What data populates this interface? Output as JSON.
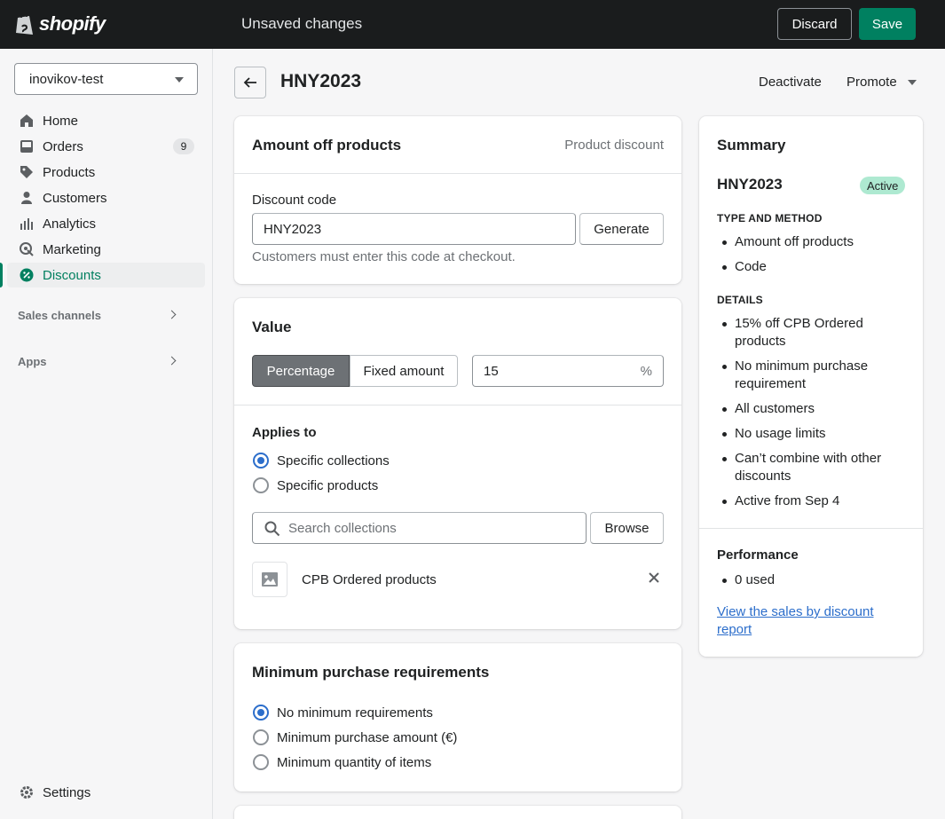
{
  "topbar": {
    "logo_text": "shopify",
    "status": "Unsaved changes",
    "discard_label": "Discard",
    "save_label": "Save"
  },
  "sidebar": {
    "store_name": "inovikov-test",
    "items": [
      {
        "label": "Home",
        "icon": "home-icon"
      },
      {
        "label": "Orders",
        "icon": "orders-icon",
        "badge": "9"
      },
      {
        "label": "Products",
        "icon": "tag-icon"
      },
      {
        "label": "Customers",
        "icon": "person-icon"
      },
      {
        "label": "Analytics",
        "icon": "bar-chart-icon"
      },
      {
        "label": "Marketing",
        "icon": "target-icon"
      },
      {
        "label": "Discounts",
        "icon": "discount-icon",
        "active": true
      }
    ],
    "sales_channels_label": "Sales channels",
    "apps_label": "Apps",
    "settings_label": "Settings"
  },
  "header": {
    "title": "HNY2023",
    "deactivate_label": "Deactivate",
    "promote_label": "Promote"
  },
  "discount_card": {
    "title": "Amount off products",
    "type_label": "Product discount",
    "code_label": "Discount code",
    "code_value": "HNY2023",
    "generate_label": "Generate",
    "help_text": "Customers must enter this code at checkout."
  },
  "value_card": {
    "title": "Value",
    "percentage_label": "Percentage",
    "fixed_amount_label": "Fixed amount",
    "value": "15",
    "suffix": "%",
    "applies_to_label": "Applies to",
    "option_collections": "Specific collections",
    "option_products": "Specific products",
    "search_placeholder": "Search collections",
    "browse_label": "Browse",
    "selected_collection": "CPB Ordered products"
  },
  "min_card": {
    "title": "Minimum purchase requirements",
    "option_none": "No minimum requirements",
    "option_amount": "Minimum purchase amount (€)",
    "option_quantity": "Minimum quantity of items"
  },
  "summary": {
    "title": "Summary",
    "code": "HNY2023",
    "status": "Active",
    "type_heading": "TYPE AND METHOD",
    "type_items": [
      "Amount off products",
      "Code"
    ],
    "details_heading": "DETAILS",
    "details_items": [
      "15% off CPB Ordered products",
      "No minimum purchase requirement",
      "All customers",
      "No usage limits",
      "Can’t combine with other discounts",
      "Active from Sep 4"
    ],
    "performance_title": "Performance",
    "performance_items": [
      "0 used"
    ],
    "report_link": "View the sales by discount report"
  },
  "colors": {
    "brand_green": "#008060",
    "active_badge": "#aee9d1",
    "link_blue": "#2c6ecb"
  }
}
